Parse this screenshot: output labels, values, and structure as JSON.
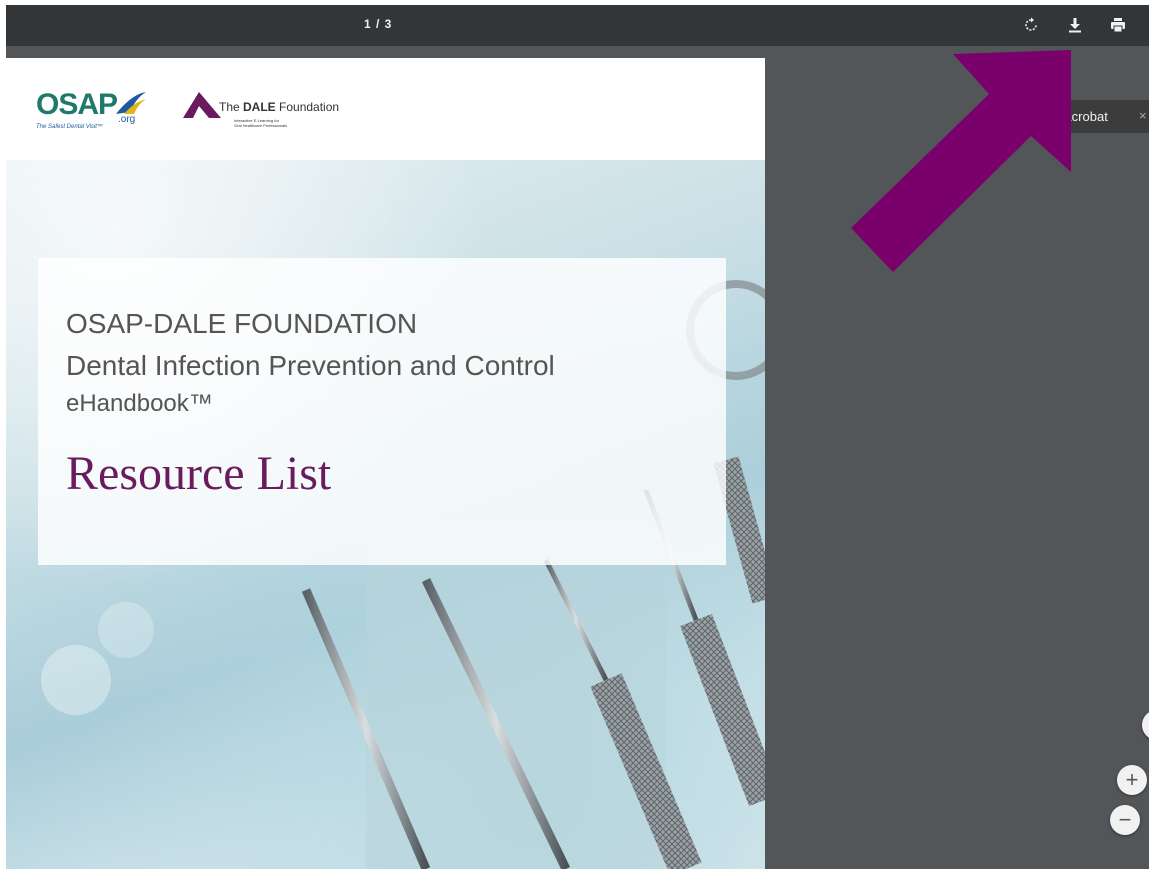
{
  "toolbar": {
    "page_counter": "1 / 3",
    "rotate_icon": "rotate-icon",
    "download_icon": "download-icon",
    "print_icon": "print-icon"
  },
  "document": {
    "osap_logo_text": "OSAP",
    "osap_org": ".org",
    "osap_tagline": "The Safest Dental Visit™",
    "dale_name_prefix": "The ",
    "dale_name_bold": "DALE",
    "dale_name_suffix": " Foundation",
    "dale_sub_1": "Interactive E-Learning for",
    "dale_sub_2": "Oral Healthcare Professionals",
    "title_line1": "OSAP-DALE FOUNDATION",
    "title_line2": "Dental Infection Prevention and Control",
    "title_line3": "eHandbook™",
    "title_main": "Resource List"
  },
  "banner": {
    "label": "Acrobat",
    "close": "×"
  },
  "zoom": {
    "zoom_in": "+",
    "zoom_out": "−"
  },
  "colors": {
    "toolbar_bg": "#323639",
    "viewer_bg": "#525659",
    "arrow": "#7a006b",
    "title_purple": "#6a1b5e"
  }
}
